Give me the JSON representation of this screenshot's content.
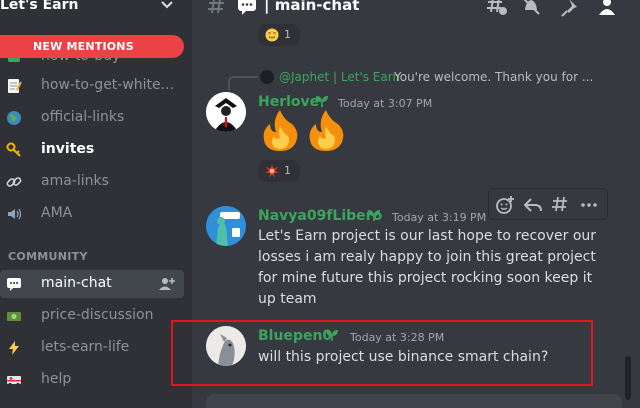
{
  "server": {
    "name": "Let's Earn"
  },
  "sidebar": {
    "new_mentions": "NEW MENTIONS",
    "channels": [
      {
        "label": "how-to-buy",
        "icon": "green-square-icon"
      },
      {
        "label": "how-to-get-white...",
        "icon": "memo-icon"
      },
      {
        "label": "official-links",
        "icon": "globe-icon"
      },
      {
        "label": "invites",
        "icon": "key-icon",
        "unread": true
      },
      {
        "label": "ama-links",
        "icon": "link-icon"
      },
      {
        "label": "AMA",
        "icon": "speaker-icon"
      }
    ],
    "category": "COMMUNITY",
    "community_channels": [
      {
        "label": "main-chat",
        "icon": "speech-bubble-icon",
        "active": true
      },
      {
        "label": "price-discussion",
        "icon": "banknote-icon"
      },
      {
        "label": "lets-earn-life",
        "icon": "lightning-icon"
      },
      {
        "label": "help",
        "icon": "ambulance-icon"
      }
    ]
  },
  "header": {
    "channel_title": "| main-chat"
  },
  "messages": {
    "top_reaction": {
      "emoji": "smiling-face-emoji",
      "count": "1"
    },
    "herlove": {
      "reply_to": "@Japhet | Let's Earn",
      "reply_text": "You're welcome. Thank you for ...",
      "author": "Herlove",
      "time": "Today at 3:07 PM",
      "content": "fire-emoji fire-emoji",
      "reaction": {
        "emoji": "collision-emoji",
        "count": "1"
      }
    },
    "navya": {
      "author": "Navya09fLibero",
      "time": "Today at 3:19 PM",
      "lines": [
        "Let's Earn project is our last hope to recover our",
        "losses i am realy happy to join this great project",
        "for mine future this project rocking soon keep it",
        "up team"
      ]
    },
    "bluepen": {
      "author": "Bluepen0",
      "time": "Today at 3:28 PM",
      "content": "will this project use binance smart chain?"
    }
  },
  "colors": {
    "sidebar_bg": "#2f3136",
    "chat_bg": "#36393f",
    "username_green": "#3ba55c",
    "mention_red": "#ed4245",
    "highlight_red": "#e4151a"
  }
}
